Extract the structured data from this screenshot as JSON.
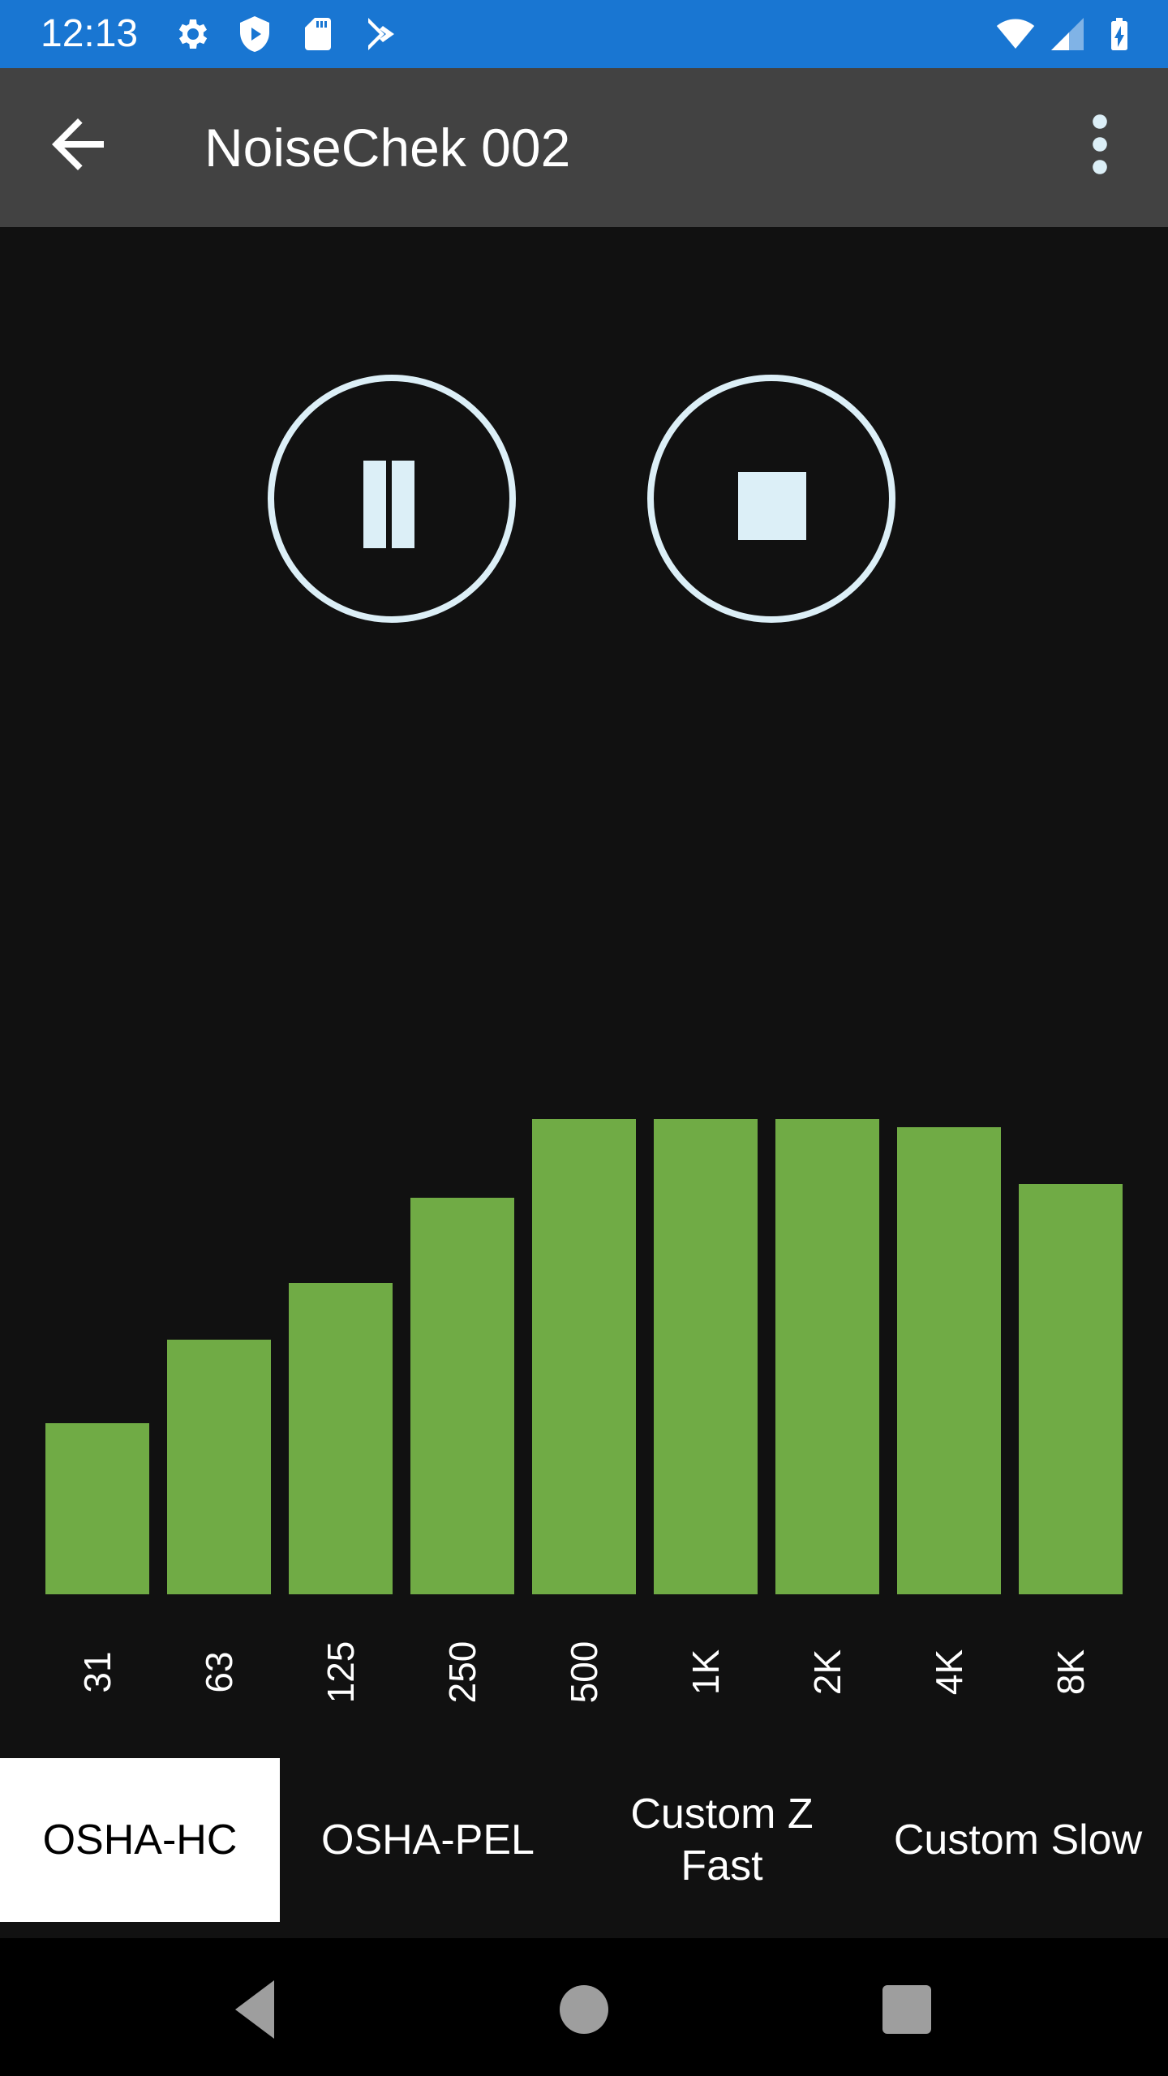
{
  "status_bar": {
    "time": "12:13",
    "icons": [
      "settings-icon",
      "shield-play-icon",
      "sd-card-icon",
      "play-store-icon",
      "wifi-icon",
      "cell-signal-icon",
      "battery-charging-icon"
    ],
    "background_color": "#1976D2"
  },
  "app_bar": {
    "title": "NoiseChek 002",
    "back_icon": "arrow-back-icon",
    "menu_icon": "more-vert-icon",
    "background_color": "#424242"
  },
  "controls": {
    "pause_icon": "pause-icon",
    "stop_icon": "stop-icon",
    "accent_color": "#DCEFF7"
  },
  "chart_data": {
    "type": "bar",
    "title": "",
    "xlabel": "",
    "ylabel": "",
    "categories": [
      "31",
      "63",
      "125",
      "250",
      "500",
      "1K",
      "2K",
      "4K",
      "8K"
    ],
    "values": [
      0.36,
      0.535,
      0.655,
      0.835,
      1.0,
      1.0,
      1.0,
      0.983,
      0.864
    ],
    "value_units": "relative level (fraction of max bar)",
    "ylim": [
      0,
      1
    ],
    "grid": false,
    "bar_color": "#70AB45"
  },
  "tabs": [
    {
      "label": "OSHA-HC",
      "active": true
    },
    {
      "label": "OSHA-PEL",
      "active": false
    },
    {
      "label": "Custom Z Fast",
      "active": false
    },
    {
      "label": "Custom Slow",
      "active": false
    }
  ],
  "nav_bar": {
    "back": "nav-back-icon",
    "home": "nav-home-icon",
    "recents": "nav-recents-icon"
  }
}
